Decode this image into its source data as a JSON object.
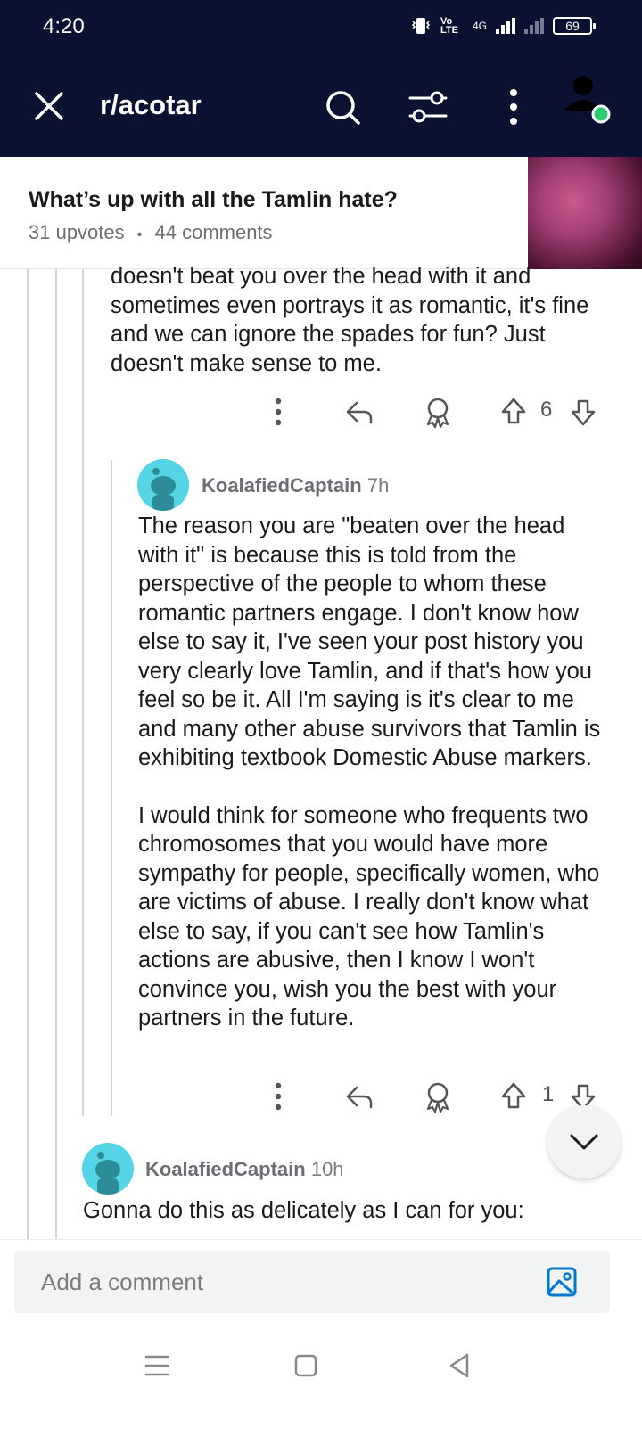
{
  "status": {
    "time": "4:20",
    "volte": "Vo LTE",
    "network": "4G",
    "battery": "69"
  },
  "header": {
    "subreddit": "r/acotar"
  },
  "post": {
    "title": "What’s up with all the Tamlin hate?",
    "upvotes": "31 upvotes",
    "separator": "•",
    "comments": "44 comments"
  },
  "comments": [
    {
      "text": "doesn't beat you over the head with it and sometimes even portrays it as romantic, it's fine and we can ignore the spades for fun? Just doesn't make sense to me.",
      "score": "6"
    },
    {
      "author": "KoalafiedCaptain",
      "time": "7h",
      "paragraphs": [
        "The reason you are \"beaten over the head with it\" is because this is told from the perspective of the people to whom these romantic partners engage. I don't know how else to say it, I've seen your post history you very clearly love Tamlin, and if that's how you feel so be it. All I'm saying is it's clear to me and many other abuse survivors that Tamlin is exhibiting textbook Domestic Abuse markers.",
        "I would think for someone who frequents two chromosomes that you would have more sympathy for people, specifically women, who are victims of abuse. I really don't know what else to say, if you can't see how Tamlin's actions are abusive, then I know I won't convince you, wish you the best with your partners in the future."
      ],
      "score": "1"
    },
    {
      "author": "KoalafiedCaptain",
      "time": "10h",
      "text": "Gonna do this as delicately as I can for you:"
    }
  ],
  "composer": {
    "placeholder": "Add a comment"
  },
  "icons": {
    "close": "close-icon",
    "search": "search-icon",
    "filter": "filter-icon",
    "more": "more-vertical-icon",
    "reply": "reply-icon",
    "award": "award-icon",
    "upvote": "upvote-icon",
    "downvote": "downvote-icon",
    "image": "image-icon",
    "collapse": "chevron-down-icon"
  },
  "colors": {
    "topbar": "#0b1130",
    "avatar": "#54d4e4",
    "accent": "#0079d3",
    "online": "#2ecc71"
  }
}
